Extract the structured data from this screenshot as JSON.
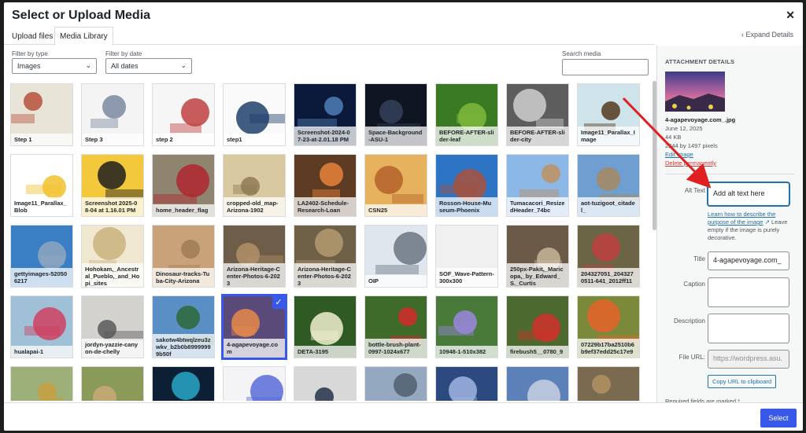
{
  "modal": {
    "title": "Select or Upload Media",
    "close_icon": "close-icon",
    "tabs": [
      "Upload files",
      "Media Library"
    ],
    "expand": "Expand Details"
  },
  "filters": {
    "type_label": "Filter by type",
    "type_value": "Images",
    "date_label": "Filter by date",
    "date_value": "All dates",
    "search_label": "Search media",
    "search_value": ""
  },
  "tiles": [
    {
      "cap": "Step 1",
      "bg": "#e9e4d8",
      "accent": "#b6513e"
    },
    {
      "cap": "Step 3",
      "bg": "#f4f4f4",
      "accent": "#7a8aa0"
    },
    {
      "cap": "step 2",
      "bg": "#f6f6f6",
      "accent": "#c04040"
    },
    {
      "cap": "step1",
      "bg": "#fafafa",
      "accent": "#1f3f6b"
    },
    {
      "cap": "Screenshot-2024-07-23-at-2.01.18 PM",
      "bg": "#0b1a3a",
      "accent": "#4f7fb8"
    },
    {
      "cap": "Space-Background-ASU-1",
      "bg": "#101522",
      "accent": "#34405a"
    },
    {
      "cap": "BEFORE-AFTER-slider-leaf",
      "bg": "#3a7a22",
      "accent": "#7fb83c"
    },
    {
      "cap": "BEFORE-AFTER-slider-city",
      "bg": "#5d5d5d",
      "accent": "#cfcfcf"
    },
    {
      "cap": "Image11_Parallax_Image",
      "bg": "#cfe3ea",
      "accent": "#55391f"
    },
    {
      "cap": "Image11_Parallax_Blob",
      "bg": "#ffffff",
      "accent": "#f2c12e"
    },
    {
      "cap": "Screenshot 2025-08-04 at 1.16.01 PM",
      "bg": "#f3c83a",
      "accent": "#1d1d1d"
    },
    {
      "cap": "home_header_flag",
      "bg": "#8e8470",
      "accent": "#b0262e"
    },
    {
      "cap": "cropped-old_map-Arizona-1902",
      "bg": "#d9c9a0",
      "accent": "#8e7a55"
    },
    {
      "cap": "LA2402-Schedule-Research-Loan",
      "bg": "#5e3b23",
      "accent": "#e8823a"
    },
    {
      "cap": "CSN25",
      "bg": "#e7b25d",
      "accent": "#b3602a"
    },
    {
      "cap": "Rosson-House-Museum-Phoenix",
      "bg": "#2e74c4",
      "accent": "#a7523c"
    },
    {
      "cap": "Tumacacori_ResizedHeader_74bc",
      "bg": "#8bb8e6",
      "accent": "#c09060"
    },
    {
      "cap": "aot-tuzigoot_citadel_",
      "bg": "#6f9ed0",
      "accent": "#a88760"
    },
    {
      "cap": "gettyimages-520506217",
      "bg": "#3a7fc4",
      "accent": "#8ea6c0"
    },
    {
      "cap": "Hohokam,_Ancestral_Pueblo,_and_Hopi_sites",
      "bg": "#f0e7d0",
      "accent": "#c9b27c"
    },
    {
      "cap": "Dinosaur-tracks-Tuba-City-Arizona",
      "bg": "#c9a27a",
      "accent": "#a07c55"
    },
    {
      "cap": "Arizona-Heritage-Center-Photos-6-2023",
      "bg": "#6e5d48",
      "accent": "#b09068"
    },
    {
      "cap": "Arizona-Heritage-Center-Photos-6-2023",
      "bg": "#6f6048",
      "accent": "#b49a70"
    },
    {
      "cap": "OIP",
      "bg": "#dfe6ee",
      "accent": "#6c7580"
    },
    {
      "cap": "SOF_Wave-Pattern-300x300",
      "bg": "#f0f0f1",
      "accent": "#f0f0f1"
    },
    {
      "cap": "250px-Pakit,_Maricopa,_by_Edward_S._Curtis",
      "bg": "#6a5a47",
      "accent": "#c8b69a"
    },
    {
      "cap": "204327051_2043270511-641_2012ff11",
      "bg": "#6b6545",
      "accent": "#c04040"
    },
    {
      "cap": "hualapai-1",
      "bg": "#a0c0d8",
      "accent": "#d04060"
    },
    {
      "cap": "jordyn-yazzie-canyon-de-chelly",
      "bg": "#d4d2cf",
      "accent": "#5a5a5a"
    },
    {
      "cap": "sakotw4btwqlzeu3zwkv_b2b0b89999999b50f",
      "bg": "#5a8fc6",
      "accent": "#2d6a3a"
    },
    {
      "cap": "4-agapevoyage.com",
      "bg": "#5a4a7a",
      "accent": "#e88a4a"
    },
    {
      "cap": "DETA-3195",
      "bg": "#2f5a24",
      "accent": "#f0efcf"
    },
    {
      "cap": "bottle-brush-plant-0997-1024x677",
      "bg": "#3e6a2a",
      "accent": "#d42a2a"
    },
    {
      "cap": "10948-1-510x382",
      "bg": "#4a7a3a",
      "accent": "#9a86e0"
    },
    {
      "cap": "firebush5__0780_9",
      "bg": "#4c6a30",
      "accent": "#d0302a"
    },
    {
      "cap": "07229b17ba2510b6b9ef37edd25c17e9",
      "bg": "#7a8a3a",
      "accent": "#e8622a"
    },
    {
      "cap": "",
      "bg": "#9db07a",
      "accent": "#c8a040"
    },
    {
      "cap": "",
      "bg": "#8a9a58",
      "accent": "#c9a977"
    },
    {
      "cap": "",
      "bg": "#0d1f35",
      "accent": "#29a7c7"
    },
    {
      "cap": "",
      "bg": "#f4f4f6",
      "accent": "#5b6bd8"
    },
    {
      "cap": "",
      "bg": "#d8d8d8",
      "accent": "#24324a"
    },
    {
      "cap": "",
      "bg": "#94a8c0",
      "accent": "#506070"
    },
    {
      "cap": "",
      "bg": "#2d4a80",
      "accent": "#a0b4e0"
    },
    {
      "cap": "",
      "bg": "#5c80b8",
      "accent": "#c8d0e0"
    },
    {
      "cap": "",
      "bg": "#7a6a50",
      "accent": "#b09060"
    }
  ],
  "selected_index": 30,
  "details": {
    "heading": "ATTACHMENT DETAILS",
    "filename": "4-agapevoyage.com_.jpg",
    "date": "June 12, 2025",
    "size": "44 KB",
    "dimensions": "2244 by 1497 pixels",
    "edit": "Edit Image",
    "delete": "Delete permanently",
    "alt_label": "Alt Text",
    "alt_value": "Add alt text here",
    "help_link": "Learn how to describe the purpose of the image",
    "help_text": "Leave empty if the image is purely decorative.",
    "title_label": "Title",
    "title_value": "4-agapevoyage.com_",
    "caption_label": "Caption",
    "caption_value": "",
    "description_label": "Description",
    "description_value": "",
    "fileurl_label": "File URL:",
    "fileurl_value": "https://wordpress.asu.",
    "copy": "Copy URL to clipboard",
    "required": "Required fields are marked *"
  },
  "footer": {
    "select": "Select"
  },
  "colors": {
    "accent": "#3858e9",
    "link": "#2271b1",
    "danger": "#d63638",
    "annotation": "#e02020"
  }
}
